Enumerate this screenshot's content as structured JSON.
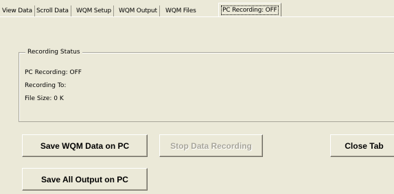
{
  "tabs": [
    {
      "label": "View Data"
    },
    {
      "label": "Scroll Data"
    },
    {
      "label": "WQM Setup"
    },
    {
      "label": "WQM Output"
    },
    {
      "label": "WQM Files"
    },
    {
      "label": "PC Recording:  OFF"
    }
  ],
  "recording_status": {
    "title": "Recording Status",
    "pc_recording": "PC Recording:  OFF",
    "recording_to": "Recording To:",
    "file_size": "File Size: 0 K"
  },
  "buttons": {
    "save_wqm": "Save WQM Data on PC",
    "stop_recording": "Stop Data Recording",
    "close_tab": "Close Tab",
    "save_all": "Save All Output on PC"
  }
}
